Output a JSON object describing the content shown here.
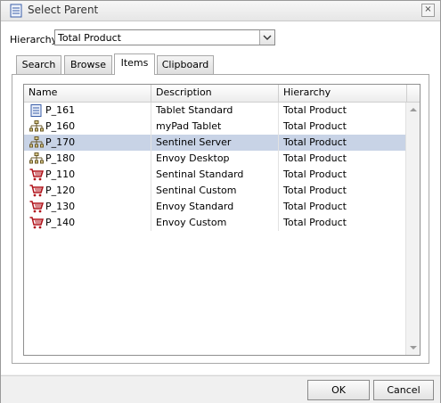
{
  "window": {
    "title": "Select Parent",
    "title_icon": "document-icon",
    "close_label": "×"
  },
  "hierarchy": {
    "label": "Hierarchy",
    "value": "Total Product"
  },
  "tabs": [
    {
      "label": "Search",
      "active": false
    },
    {
      "label": "Browse",
      "active": false
    },
    {
      "label": "Items",
      "active": true
    },
    {
      "label": "Clipboard",
      "active": false
    }
  ],
  "grid": {
    "columns": [
      "Name",
      "Description",
      "Hierarchy"
    ],
    "rows": [
      {
        "name": "P_161",
        "description": "Tablet Standard",
        "hierarchy": "Total Product",
        "icon": "document-icon",
        "selected": false
      },
      {
        "name": "P_160",
        "description": "myPad Tablet",
        "hierarchy": "Total Product",
        "icon": "hierarchy-icon",
        "selected": false
      },
      {
        "name": "P_170",
        "description": "Sentinel Server",
        "hierarchy": "Total Product",
        "icon": "hierarchy-icon",
        "selected": true
      },
      {
        "name": "P_180",
        "description": "Envoy Desktop",
        "hierarchy": "Total Product",
        "icon": "hierarchy-icon",
        "selected": false
      },
      {
        "name": "P_110",
        "description": "Sentinal Standard",
        "hierarchy": "Total Product",
        "icon": "cart-icon",
        "selected": false
      },
      {
        "name": "P_120",
        "description": "Sentinal Custom",
        "hierarchy": "Total Product",
        "icon": "cart-icon",
        "selected": false
      },
      {
        "name": "P_130",
        "description": "Envoy Standard",
        "hierarchy": "Total Product",
        "icon": "cart-icon",
        "selected": false
      },
      {
        "name": "P_140",
        "description": "Envoy Custom",
        "hierarchy": "Total Product",
        "icon": "cart-icon",
        "selected": false
      }
    ]
  },
  "buttons": {
    "ok": "OK",
    "cancel": "Cancel"
  },
  "colors": {
    "selected_row": "#c8d3e6",
    "doc_icon": "#3a5ea8",
    "cart_icon": "#b0121a",
    "tree_icon": "#6a5a2a"
  }
}
